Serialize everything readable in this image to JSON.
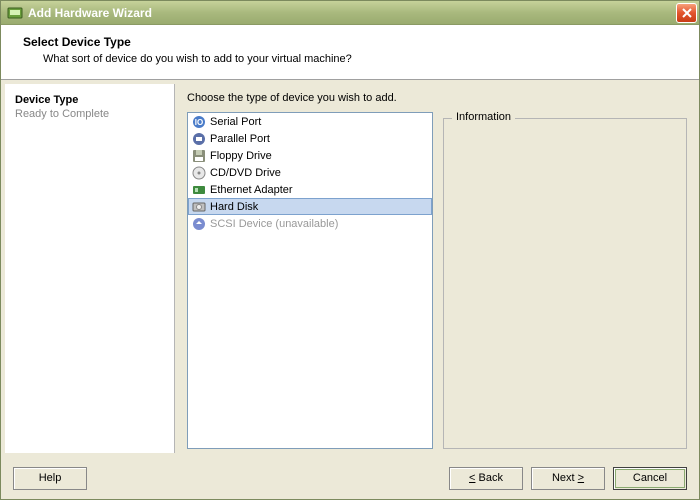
{
  "window": {
    "title": "Add Hardware Wizard"
  },
  "header": {
    "title": "Select Device Type",
    "subtitle": "What sort of device do you wish to add to your virtual machine?"
  },
  "sidebar": {
    "steps": [
      {
        "label": "Device Type",
        "active": true
      },
      {
        "label": "Ready to Complete",
        "active": false
      }
    ]
  },
  "main": {
    "prompt": "Choose the type of device you wish to add.",
    "info_legend": "Information",
    "devices": [
      {
        "label": "Serial Port",
        "icon": "serial",
        "selected": false,
        "disabled": false
      },
      {
        "label": "Parallel Port",
        "icon": "parallel",
        "selected": false,
        "disabled": false
      },
      {
        "label": "Floppy Drive",
        "icon": "floppy",
        "selected": false,
        "disabled": false
      },
      {
        "label": "CD/DVD Drive",
        "icon": "cd",
        "selected": false,
        "disabled": false
      },
      {
        "label": "Ethernet Adapter",
        "icon": "nic",
        "selected": false,
        "disabled": false
      },
      {
        "label": "Hard Disk",
        "icon": "hdd",
        "selected": true,
        "disabled": false
      },
      {
        "label": "SCSI Device (unavailable)",
        "icon": "scsi",
        "selected": false,
        "disabled": true
      }
    ]
  },
  "footer": {
    "help": "Help",
    "back": "Back",
    "next": "Next",
    "cancel": "Cancel"
  }
}
